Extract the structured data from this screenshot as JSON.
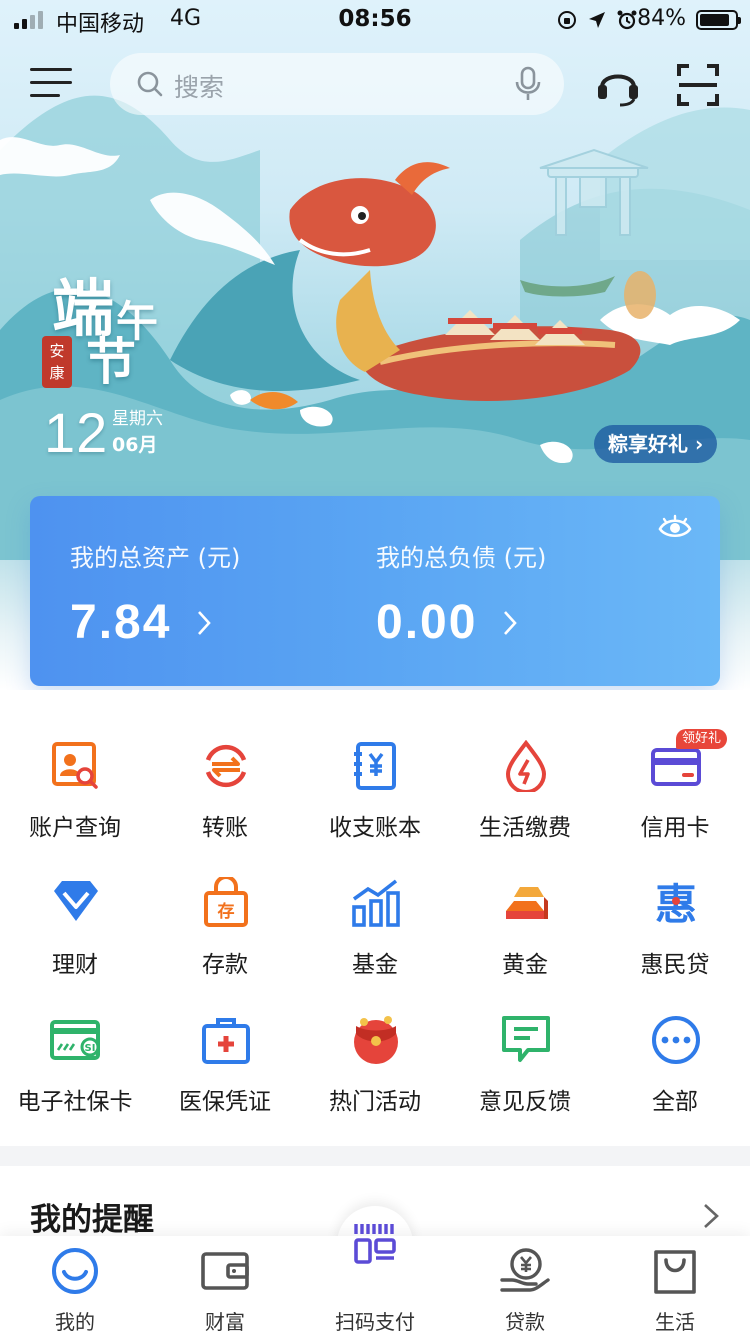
{
  "status_bar": {
    "carrier": "中国移动",
    "network": "4G",
    "time": "08:56",
    "battery_percent": "84%",
    "battery_level": 0.84,
    "signal_bars": 2,
    "icons": [
      "orientation-lock-icon",
      "location-icon",
      "alarm-icon"
    ]
  },
  "header": {
    "search_placeholder": "搜索",
    "icons": [
      "menu-icon",
      "search-icon",
      "mic-icon",
      "customer-service-icon",
      "scan-icon"
    ]
  },
  "banner": {
    "festival_chars": [
      "端",
      "午",
      "节"
    ],
    "seal_text": [
      "安",
      "康"
    ],
    "day": "12",
    "weekday": "星期六",
    "month": "06月",
    "promo_label": "粽享好礼 ›"
  },
  "assets": {
    "total_assets_label": "我的总资产 (元)",
    "total_assets_value": "7.84",
    "total_liabilities_label": "我的总负债 (元)",
    "total_liabilities_value": "0.00"
  },
  "services": [
    {
      "label": "账户查询",
      "icon": "account-query-icon"
    },
    {
      "label": "转账",
      "icon": "transfer-icon"
    },
    {
      "label": "收支账本",
      "icon": "ledger-icon"
    },
    {
      "label": "生活缴费",
      "icon": "utility-payment-icon"
    },
    {
      "label": "信用卡",
      "icon": "credit-card-icon"
    },
    {
      "label": "理财",
      "icon": "wealth-management-icon"
    },
    {
      "label": "存款",
      "icon": "deposit-icon"
    },
    {
      "label": "基金",
      "icon": "fund-icon"
    },
    {
      "label": "黄金",
      "icon": "gold-icon"
    },
    {
      "label": "惠民贷",
      "icon": "huimin-loan-icon"
    },
    {
      "label": "电子社保卡",
      "icon": "social-security-card-icon"
    },
    {
      "label": "医保凭证",
      "icon": "medical-insurance-icon"
    },
    {
      "label": "热门活动",
      "icon": "red-envelope-icon"
    },
    {
      "label": "意见反馈",
      "icon": "feedback-icon"
    },
    {
      "label": "全部",
      "icon": "more-icon"
    }
  ],
  "credit_card_badge": "领好礼",
  "reminder": {
    "title": "我的提醒"
  },
  "tabbar": [
    {
      "label": "我的",
      "icon": "smile-icon",
      "active": true
    },
    {
      "label": "财富",
      "icon": "wallet-icon",
      "active": false
    },
    {
      "label": "扫码支付",
      "icon": "scan-pay-icon",
      "active": false
    },
    {
      "label": "贷款",
      "icon": "loan-icon",
      "active": false
    },
    {
      "label": "生活",
      "icon": "shopping-bag-icon",
      "active": false
    }
  ],
  "colors": {
    "card_gradient_start": "#4e92f0",
    "card_gradient_end": "#6bb8f7",
    "icon_orange": "#f2711c",
    "icon_red": "#e5443b",
    "icon_blue": "#2f7be9",
    "icon_green": "#2fb36b"
  }
}
